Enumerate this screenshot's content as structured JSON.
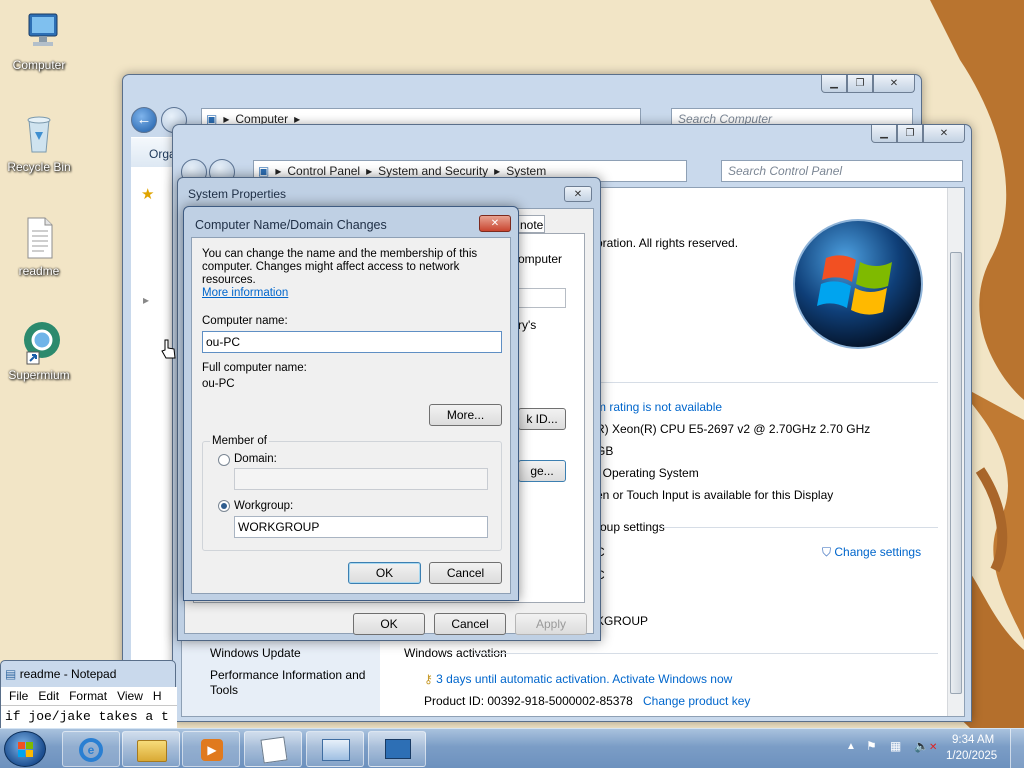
{
  "desktop": {
    "icons": [
      {
        "label": "Computer",
        "icon": "computer-icon"
      },
      {
        "label": "Recycle Bin",
        "icon": "recycle-bin-icon"
      },
      {
        "label": "readme",
        "icon": "text-file-icon"
      },
      {
        "label": "Supermium",
        "icon": "browser-icon"
      }
    ]
  },
  "explorer": {
    "address": "Computer",
    "search_placeholder": "Search Computer",
    "organize_label": "Orga"
  },
  "system_window": {
    "breadcrumb": [
      "Control Panel",
      "System and Security",
      "System"
    ],
    "search_placeholder": "Search Control Panel",
    "copyright_text": "oration.  All rights reserved.",
    "rating_text": "m rating is not available",
    "processor_text": "R) Xeon(R) CPU E5-2697 v2 @ 2.70GHz   2.70 GHz",
    "memory_text": "GB",
    "system_type_text": "t Operating System",
    "pen_text": "en or Touch Input is available for this Display",
    "group_settings_text": "roup settings",
    "computer_name_partial": "C",
    "full_name_partial": "C",
    "workgroup_partial": "KGROUP",
    "change_settings_label": "Change settings",
    "see_also_items": [
      "Windows Update",
      "Performance Information and Tools"
    ],
    "activation_heading": "Windows activation",
    "activation_text": "3 days until automatic activation. Activate Windows now",
    "product_id_label": "Product ID:  00392-918-5000002-85378",
    "change_product_key_label": "Change product key"
  },
  "system_properties": {
    "title": "System Properties",
    "tab_partial": "note",
    "description_partial": "omputer",
    "ries_partial": "ry's",
    "network_id_partial": "k ID...",
    "change_partial": "ge...",
    "ok_label": "OK",
    "cancel_label": "Cancel",
    "apply_label": "Apply"
  },
  "name_dialog": {
    "title": "Computer Name/Domain Changes",
    "intro_line1": "You can change the name and the membership of this",
    "intro_line2": "computer. Changes might affect access to network resources.",
    "more_info_link": "More information",
    "computer_name_label": "Computer name:",
    "computer_name_value": "ou-PC",
    "full_name_label": "Full computer name:",
    "full_name_value": "ou-PC",
    "more_button": "More...",
    "member_of_label": "Member of",
    "domain_label": "Domain:",
    "domain_value": "",
    "workgroup_label": "Workgroup:",
    "workgroup_value": "WORKGROUP",
    "selected_membership": "Workgroup",
    "ok_label": "OK",
    "cancel_label": "Cancel"
  },
  "notepad": {
    "title": "readme - Notepad",
    "menu": [
      "File",
      "Edit",
      "Format",
      "View",
      "H"
    ],
    "content": "if joe/jake takes a t"
  },
  "taskbar": {
    "time": "9:34 AM",
    "date": "1/20/2025"
  }
}
